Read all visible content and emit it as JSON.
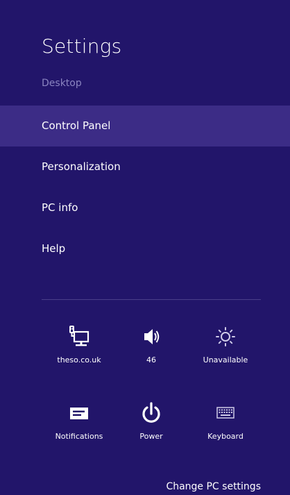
{
  "header": {
    "title": "Settings",
    "subtitle": "Desktop"
  },
  "menu": {
    "items": [
      {
        "label": "Control Panel",
        "selected": true
      },
      {
        "label": "Personalization"
      },
      {
        "label": "PC info"
      },
      {
        "label": "Help"
      }
    ]
  },
  "quick_settings": {
    "network": {
      "label": "theso.co.uk",
      "icon": "network-icon"
    },
    "volume": {
      "label": "46",
      "icon": "speaker-icon"
    },
    "brightness": {
      "label": "Unavailable",
      "icon": "brightness-icon"
    },
    "notifications": {
      "label": "Notifications",
      "icon": "notifications-icon"
    },
    "power": {
      "label": "Power",
      "icon": "power-icon"
    },
    "keyboard": {
      "label": "Keyboard",
      "icon": "keyboard-icon"
    }
  },
  "footer": {
    "change_pc_settings": "Change PC settings"
  },
  "colors": {
    "background": "#22156a",
    "selected_item": "#3c2c86",
    "subtitle": "#8a84c0"
  }
}
